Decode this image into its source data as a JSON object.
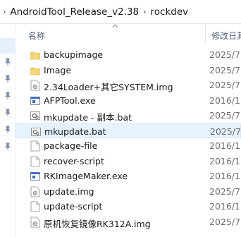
{
  "breadcrumb": {
    "items": [
      "AndroidTool_Release_v2.38",
      "rockdev"
    ]
  },
  "header": {
    "name_label": "名称",
    "date_label": "修改日其"
  },
  "colors": {
    "selection": "#e5f3ff",
    "folder": "#f8d775",
    "header_text": "#4c607a"
  },
  "files": [
    {
      "name": "backupimage",
      "date": "2025/7",
      "icon": "folder-icon"
    },
    {
      "name": "Image",
      "date": "2025/7",
      "icon": "folder-icon"
    },
    {
      "name": "2.34Loader+其它SYSTEM.img",
      "date": "2025/7",
      "icon": "img-file-icon"
    },
    {
      "name": "AFPTool.exe",
      "date": "2016/1",
      "icon": "exe-icon"
    },
    {
      "name": "mkupdate - 副本.bat",
      "date": "2025/7",
      "icon": "bat-icon"
    },
    {
      "name": "mkupdate.bat",
      "date": "2025/7",
      "icon": "bat-icon",
      "selected": true
    },
    {
      "name": "package-file",
      "date": "2016/1",
      "icon": "file-icon"
    },
    {
      "name": "recover-script",
      "date": "2016/1",
      "icon": "file-icon"
    },
    {
      "name": "RKImageMaker.exe",
      "date": "2016/1",
      "icon": "exe-icon"
    },
    {
      "name": "update.img",
      "date": "2025/7",
      "icon": "img-file-icon"
    },
    {
      "name": "update-script",
      "date": "2016/1",
      "icon": "file-icon"
    },
    {
      "name": "原机恢复镜像RK312A.img",
      "date": "2025/7",
      "icon": "img-file-icon"
    }
  ]
}
